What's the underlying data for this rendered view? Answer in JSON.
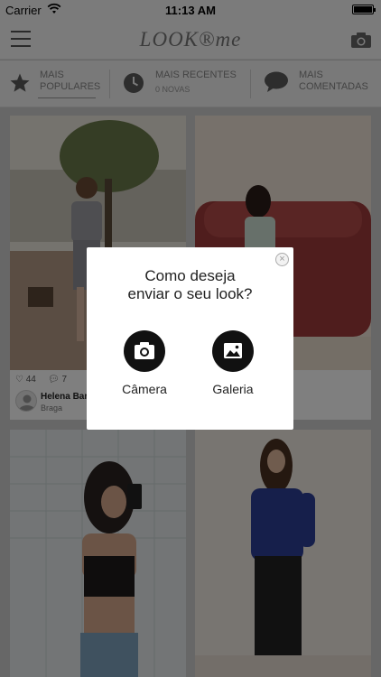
{
  "status_bar": {
    "carrier": "Carrier",
    "time": "11:13 AM"
  },
  "header": {
    "logo": "LOOK®me"
  },
  "tabs": [
    {
      "label_line1": "MAIS",
      "label_line2": "POPULARES",
      "sub": ""
    },
    {
      "label_line1": "MAIS RECENTES",
      "label_line2": "",
      "sub": "0 NOVAS"
    },
    {
      "label_line1": "MAIS",
      "label_line2": "COMENTADAS",
      "sub": ""
    }
  ],
  "feed": {
    "cards": [
      {
        "likes": "44",
        "comments": "7",
        "user_name": "Helena Bar",
        "user_place": "Braga"
      }
    ]
  },
  "modal": {
    "title_line1": "Como deseja",
    "title_line2": "enviar o seu look?",
    "close_glyph": "×",
    "options": [
      {
        "label": "Câmera",
        "icon": "camera-icon"
      },
      {
        "label": "Galeria",
        "icon": "gallery-icon"
      }
    ]
  },
  "colors": {
    "overlay": "#000000",
    "modal_bg": "#ffffff",
    "icon_circle": "#111111"
  }
}
